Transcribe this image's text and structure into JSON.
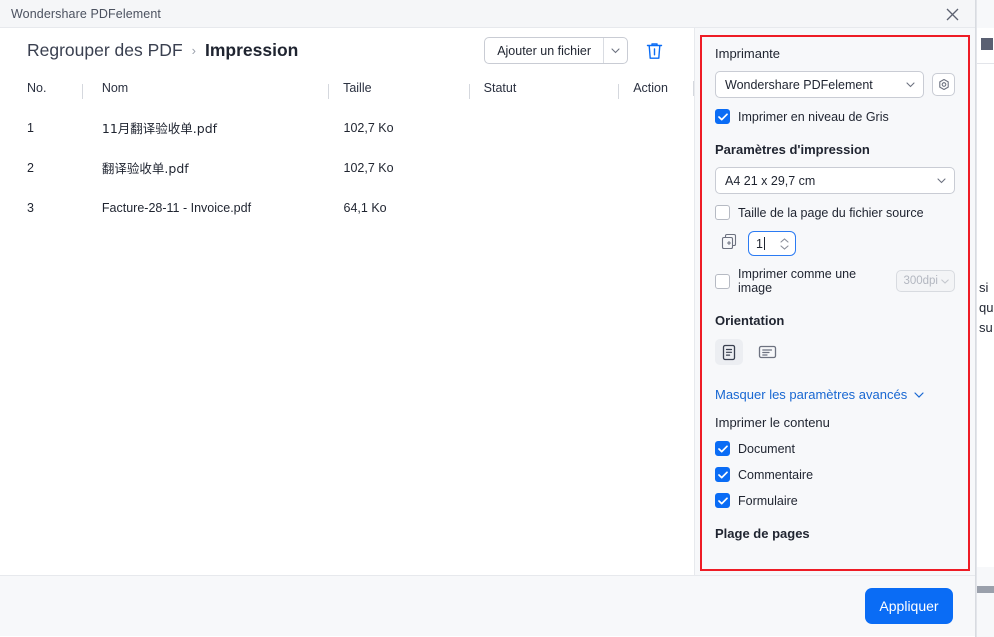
{
  "window": {
    "title": "Wondershare PDFelement",
    "close_icon": "close-icon"
  },
  "breadcrumb": {
    "parent": "Regrouper des PDF",
    "separator": "›",
    "current": "Impression"
  },
  "toolbar": {
    "add_file_label": "Ajouter un fichier",
    "add_file_chevron": "chevron-down-icon",
    "delete_icon": "trash-icon"
  },
  "table": {
    "columns": [
      "No.",
      "Nom",
      "Taille",
      "Statut",
      "Action"
    ],
    "rows": [
      {
        "no": "1",
        "name": "11月翻译验收单.pdf",
        "size": "102,7 Ko",
        "status": "",
        "action": ""
      },
      {
        "no": "2",
        "name": "翻译验收单.pdf",
        "size": "102,7 Ko",
        "status": "",
        "action": ""
      },
      {
        "no": "3",
        "name": "Facture-28-11 - Invoice.pdf",
        "size": "64,1 Ko",
        "status": "",
        "action": ""
      }
    ]
  },
  "panel": {
    "highlight_color": "#ee1c25",
    "printer": {
      "title": "Imprimante",
      "selected": "Wondershare PDFelement",
      "chevron": "chevron-down-icon",
      "settings_icon": "gear-icon",
      "grayscale": {
        "label": "Imprimer en niveau de Gris",
        "checked": true
      }
    },
    "print_settings": {
      "title": "Paramètres d'impression",
      "page_size": "A4 21 x 29,7 cm",
      "page_size_chevron": "chevron-down-icon",
      "source_size": {
        "label": "Taille de la page du fichier source",
        "checked": false
      },
      "copies_icon": "copies-icon",
      "copies_value": "1",
      "print_as_image": {
        "label": "Imprimer comme une image",
        "checked": false
      },
      "dpi_value": "300dpi",
      "dpi_chevron": "chevron-down-icon"
    },
    "orientation": {
      "title": "Orientation",
      "portrait_icon": "portrait-orientation-icon",
      "landscape_icon": "landscape-orientation-icon",
      "selected": "portrait"
    },
    "advanced_link": {
      "label": "Masquer les paramètres avancés",
      "chevron": "chevron-down-icon"
    },
    "print_content": {
      "title": "Imprimer le contenu",
      "items": [
        {
          "label": "Document",
          "checked": true
        },
        {
          "label": "Commentaire",
          "checked": true
        },
        {
          "label": "Formulaire",
          "checked": true
        }
      ]
    },
    "page_range": {
      "title": "Plage de pages"
    }
  },
  "footer": {
    "apply_label": "Appliquer",
    "apply_color": "#0a6cf5"
  },
  "background_window": {
    "line1": "si",
    "line2": "qu",
    "line3": "su"
  }
}
